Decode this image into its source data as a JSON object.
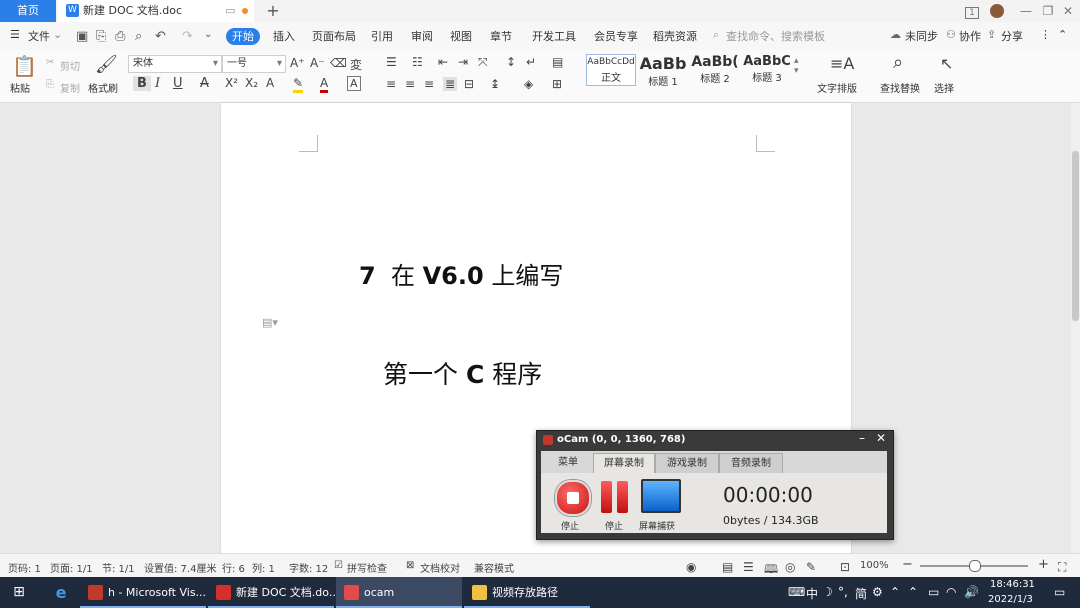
{
  "titlebar": {
    "home_tab": "首页",
    "doc_tab": "新建 DOC 文档.doc",
    "doc_tab_icon": "W",
    "new_tab": "+",
    "win_layout_badge": "1"
  },
  "menubar": {
    "file": "文件",
    "tabs": [
      "开始",
      "插入",
      "页面布局",
      "引用",
      "审阅",
      "视图",
      "章节",
      "开发工具",
      "会员专享",
      "稻壳资源"
    ],
    "search_placeholder": "查找命令、搜索模板",
    "unsync": "未同步",
    "collab": "协作",
    "share": "分享"
  },
  "ribbon": {
    "paste": "粘贴",
    "cut": "剪切",
    "copy": "复制",
    "format_painter": "格式刷",
    "font_name": "宋体",
    "font_size": "一号",
    "styles": [
      {
        "preview": "AaBbCcDd",
        "label": "正文"
      },
      {
        "preview": "AaBb",
        "label": "标题 1"
      },
      {
        "preview": "AaBb(",
        "label": "标题 2"
      },
      {
        "preview": "AaBbC",
        "label": "标题 3"
      }
    ],
    "text_layout": "文字排版",
    "find_replace": "查找替换",
    "select": "选择"
  },
  "document": {
    "heading1_num": "7",
    "heading1_cn1": "在",
    "heading1_ver": "V6.0",
    "heading1_cn2": "上编写",
    "heading2_cn1": "第一个",
    "heading2_c": "C",
    "heading2_cn2": "程序"
  },
  "ocam": {
    "title": "oCam (0, 0, 1360, 768)",
    "tabs": [
      "菜单",
      "屏幕录制",
      "游戏录制",
      "音频录制"
    ],
    "active_tab": "屏幕录制",
    "btn_stop": "停止",
    "btn_pause": "停止",
    "btn_capture": "屏幕捕获",
    "time": "00:00:00",
    "size": "0bytes / 134.3GB"
  },
  "statusbar": {
    "page_no": "页码: 1",
    "pages": "页面: 1/1",
    "section": "节: 1/1",
    "setting": "设置值: 7.4厘米",
    "row": "行: 6",
    "col": "列: 1",
    "words": "字数: 12",
    "spell": "拼写检查",
    "proof": "文档校对",
    "compat": "兼容模式",
    "zoom": "100%",
    "zoom_level": 0.5
  },
  "taskbar": {
    "items": [
      "h - Microsoft Vis...",
      "新建 DOC 文档.do...",
      "ocam",
      "视频存放路径"
    ],
    "ime": "中",
    "ime2": "简",
    "time": "18:46:31",
    "date": "2022/1/3"
  },
  "colors": {
    "accent": "#2a7fe8",
    "taskbar": "#1f2a3c",
    "ocam_red": "#c91414"
  }
}
